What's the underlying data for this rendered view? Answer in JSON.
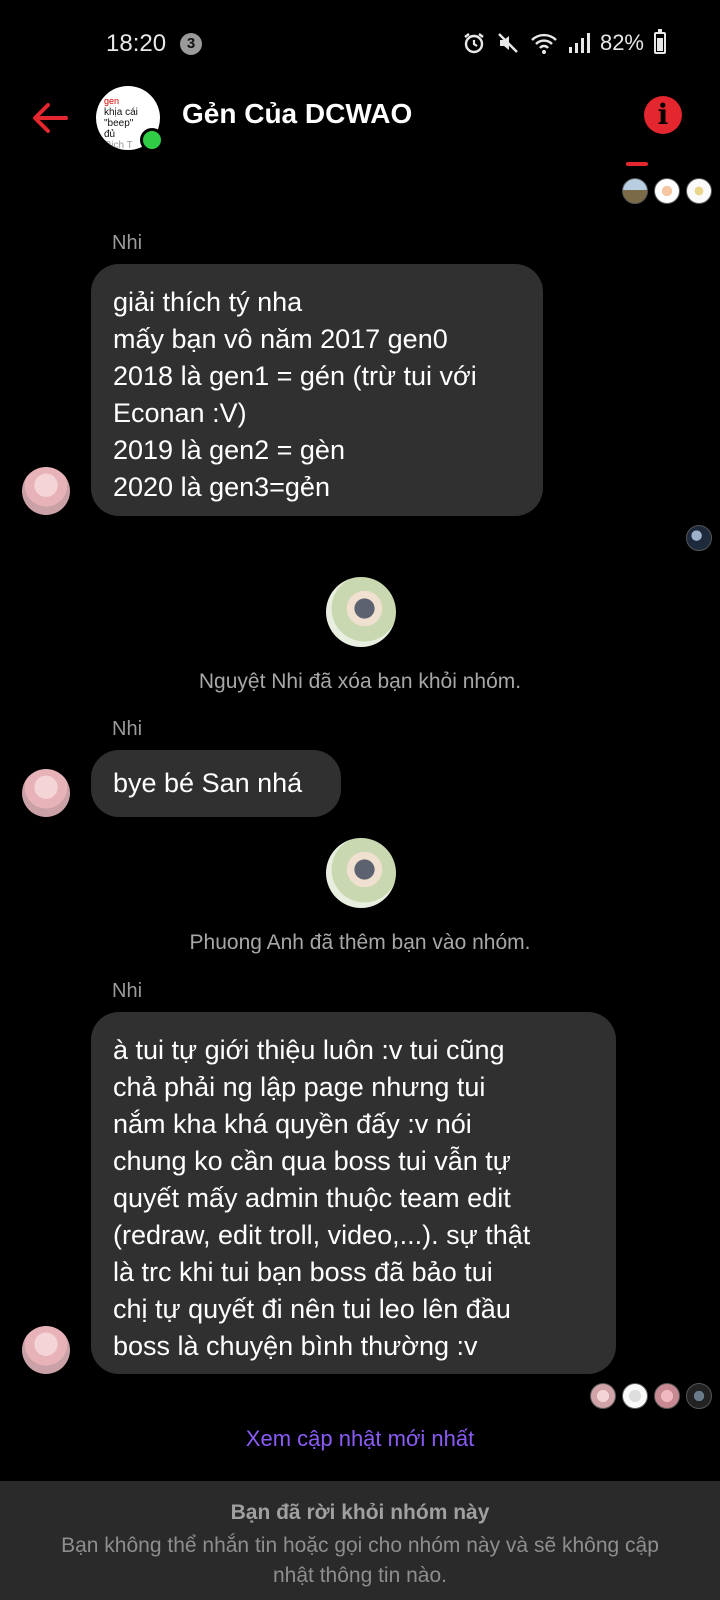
{
  "status_bar": {
    "time": "18:20",
    "notification_count": "3",
    "battery": "82%"
  },
  "header": {
    "title": "Gẻn Của DCWAO",
    "avatar_text": [
      "gen",
      "khịa cái \"beep\"",
      "đủ",
      "Rich   T"
    ]
  },
  "messages": [
    {
      "sender": "Nhi",
      "lines": [
        "giải thích tý nha",
        "mấy bạn vô năm 2017 gen0",
        "2018 là gen1 = gén (trừ tui với",
        "Econan :V)",
        "2019 là gen2 = gèn",
        "2020 là gen3=gẻn"
      ]
    },
    {
      "system": "Nguyệt Nhi đã xóa bạn khỏi nhóm."
    },
    {
      "sender": "Nhi",
      "lines": [
        "bye bé San nhá"
      ]
    },
    {
      "system": "Phuong Anh đã thêm bạn vào nhóm."
    },
    {
      "sender": "Nhi",
      "lines": [
        "à tui tự giới thiệu luôn :v tui cũng",
        "chả phải ng lập page nhưng tui",
        "nắm kha khá quyền đấy :v nói",
        "chung ko cần qua boss tui vẫn tự",
        "quyết mấy admin thuộc team edit",
        "(redraw, edit troll, video,...). sự thật",
        "là trc khi tui bạn boss đã bảo tui",
        "chị tự quyết đi nên tui leo lên đầu",
        "boss là chuyện bình thường :v"
      ]
    }
  ],
  "latest_link": "Xem cập nhật mới nhất",
  "footer": {
    "title": "Bạn đã rời khỏi nhóm này",
    "description": "Bạn không thể nhắn tin hoặc gọi cho nhóm này và sẽ không cập nhật thông tin nào."
  },
  "colors": {
    "accent_red": "#e4262f",
    "link_purple": "#8a5cf5",
    "online_green": "#31cc46",
    "bubble": "#303030"
  }
}
